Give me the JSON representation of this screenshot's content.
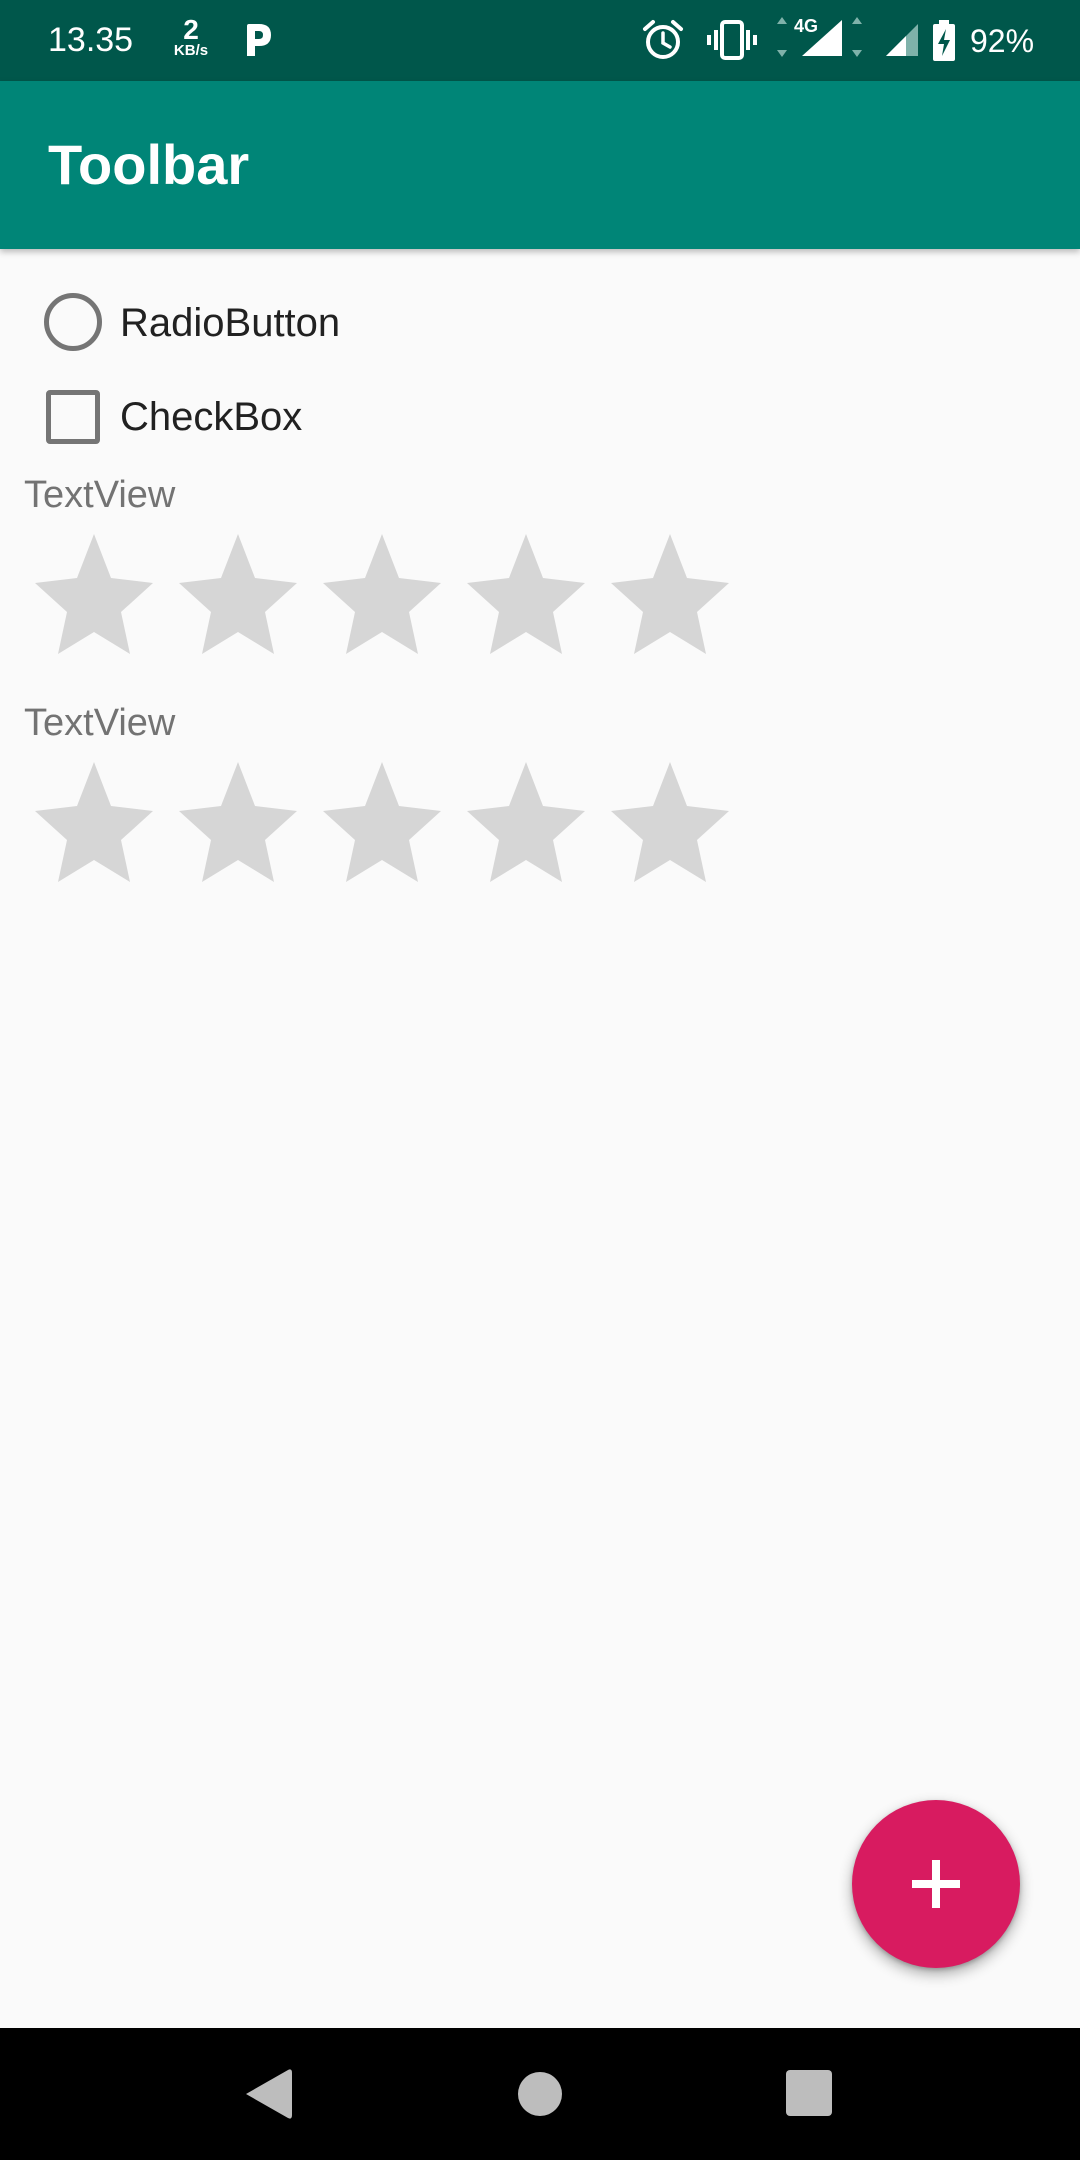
{
  "status_bar": {
    "time": "13.35",
    "net_speed_value": "2",
    "net_speed_unit": "KB/s",
    "battery_percent": "92%",
    "network_type": "4G",
    "icons": [
      "parking-icon",
      "alarm-icon",
      "vibrate-icon",
      "network-4g-icon",
      "signal-icon",
      "battery-charging-icon"
    ]
  },
  "toolbar": {
    "title": "Toolbar",
    "color": "#008577"
  },
  "content": {
    "radio_button": {
      "label": "RadioButton",
      "checked": false
    },
    "checkbox": {
      "label": "CheckBox",
      "checked": false
    },
    "text_view_1": "TextView",
    "rating_bar_1": {
      "rating": 0,
      "max": 5
    },
    "text_view_2": "TextView",
    "rating_bar_2": {
      "rating": 0,
      "max": 5
    }
  },
  "fab": {
    "icon": "plus-icon",
    "color": "#d81b60"
  },
  "nav_bar": {
    "buttons": [
      "back-icon",
      "home-icon",
      "recents-icon"
    ]
  }
}
